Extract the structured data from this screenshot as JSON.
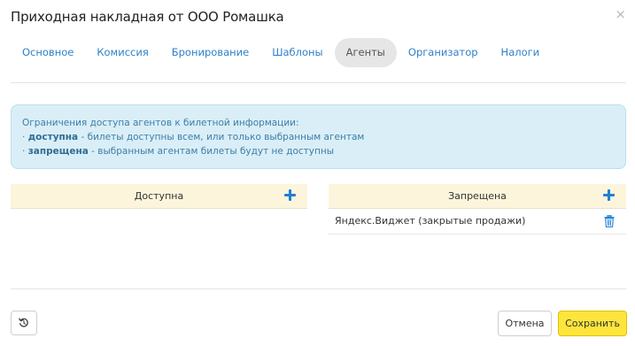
{
  "dialog": {
    "title": "Приходная накладная от ООО Ромашка",
    "close_icon": "×"
  },
  "tabs": [
    {
      "label": "Основное",
      "active": false
    },
    {
      "label": "Комиссия",
      "active": false
    },
    {
      "label": "Бронирование",
      "active": false
    },
    {
      "label": "Шаблоны",
      "active": false
    },
    {
      "label": "Агенты",
      "active": true
    },
    {
      "label": "Организатор",
      "active": false
    },
    {
      "label": "Налоги",
      "active": false
    }
  ],
  "info": {
    "line1": "Ограничения доступа агентов к билетной информации:",
    "line2_prefix": "· ",
    "line2_bold": "доступна",
    "line2_rest": " - билеты доступны всем, или только выбранным агентам",
    "line3_prefix": "· ",
    "line3_bold": "запрещена",
    "line3_rest": " - выбранным агентам билеты будут не доступны"
  },
  "allowed": {
    "header": "Доступна",
    "items": []
  },
  "denied": {
    "header": "Запрещена",
    "items": [
      {
        "label": "Яндекс.Виджет (закрытые продажи)"
      }
    ]
  },
  "footer": {
    "cancel_label": "Отмена",
    "save_label": "Сохранить"
  },
  "colors": {
    "accent": "#2f80c8",
    "save_button": "#fde53c",
    "panel_header": "#fcf5dc",
    "info_background": "#daeef7"
  }
}
